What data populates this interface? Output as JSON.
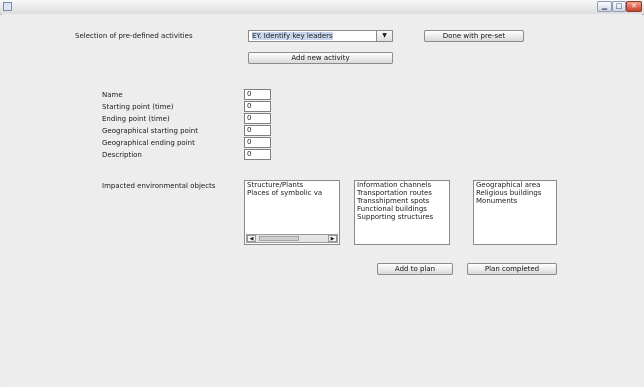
{
  "window": {
    "controls": {
      "minimize": "▁",
      "maximize": "□",
      "close": "✕"
    }
  },
  "preset": {
    "label": "Selection of pre-defined activities",
    "selected": "EY. Identify key leaders",
    "done_button": "Done with pre-set",
    "add_activity_button": "Add new activity"
  },
  "form": {
    "fields": [
      {
        "label": "Name",
        "value": "0"
      },
      {
        "label": "Starting point (time)",
        "value": "0"
      },
      {
        "label": "Ending point (time)",
        "value": "0"
      },
      {
        "label": "Geographical starting point",
        "value": "0"
      },
      {
        "label": "Geographical ending point",
        "value": "0"
      },
      {
        "label": "Description",
        "value": "0"
      }
    ]
  },
  "impacted": {
    "label": "Impacted environmental objects",
    "list1": [
      "Structure/Plants",
      "Places of symbolic va"
    ],
    "list2": [
      "Information channels",
      "Transportation routes",
      "Transshipment spots",
      "Functional buildings",
      "Supporting structures"
    ],
    "list3": [
      "Geographical area",
      "Religious buildings",
      "Monuments"
    ]
  },
  "scroll": {
    "left": "◀",
    "right": "▶"
  },
  "actions": {
    "add_to_plan": "Add to plan",
    "plan_completed": "Plan completed"
  },
  "colors": {
    "background": "#ededed",
    "selection": "#c9d6ee"
  }
}
